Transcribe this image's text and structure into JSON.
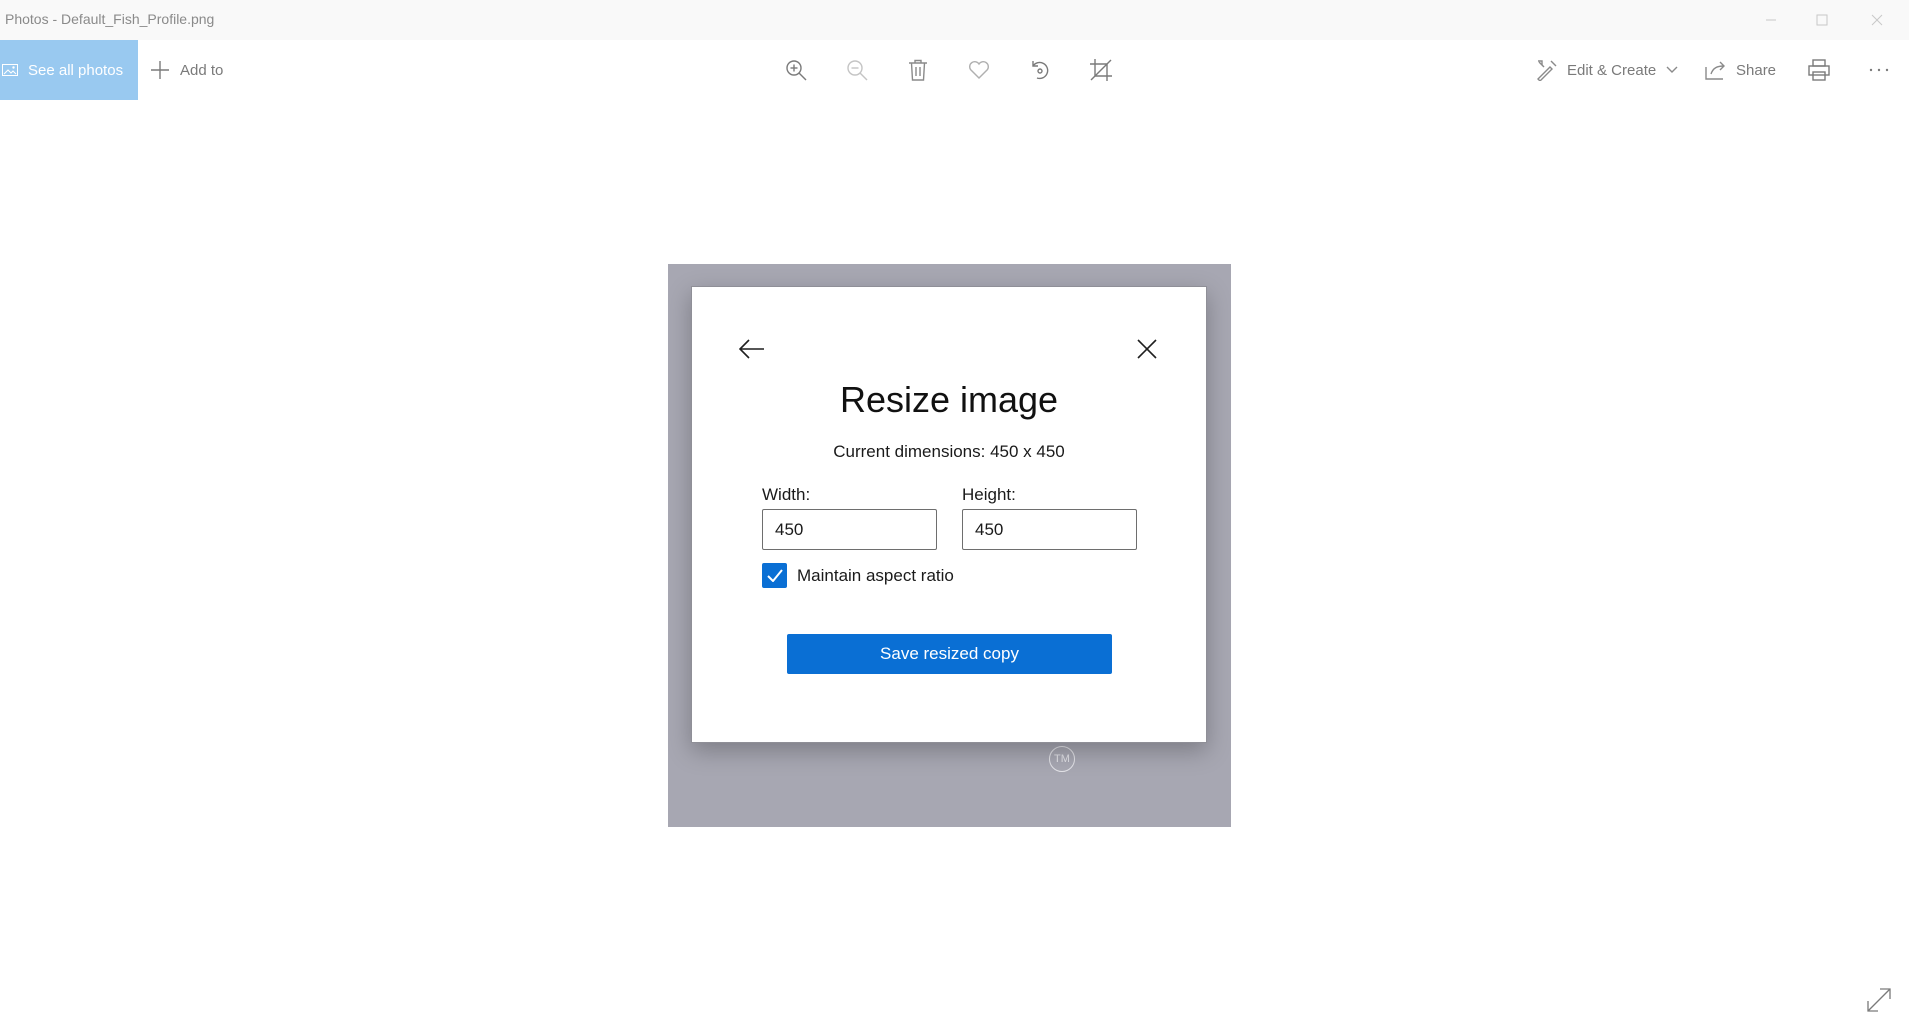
{
  "window": {
    "title": "Photos - Default_Fish_Profile.png"
  },
  "toolbar": {
    "see_all_label": "See all photos",
    "add_to_label": "Add to",
    "edit_create_label": "Edit & Create",
    "share_label": "Share",
    "icons": [
      "zoom-in-icon",
      "zoom-out-icon",
      "delete-icon",
      "favorite-icon",
      "rotate-icon",
      "crop-icon",
      "print-icon",
      "more-icon"
    ]
  },
  "photo": {
    "watermark": "TM"
  },
  "dialog": {
    "title": "Resize image",
    "current_dimensions": "Current dimensions: 450 x 450",
    "width_label": "Width:",
    "width_value": "450",
    "height_label": "Height:",
    "height_value": "450",
    "maintain_aspect_label": "Maintain aspect ratio",
    "maintain_aspect_checked": true,
    "save_label": "Save resized copy"
  },
  "colors": {
    "accent": "#0a6fd4",
    "selected_tab": "#99c9f0",
    "photo_background": "#a7a7b2"
  }
}
